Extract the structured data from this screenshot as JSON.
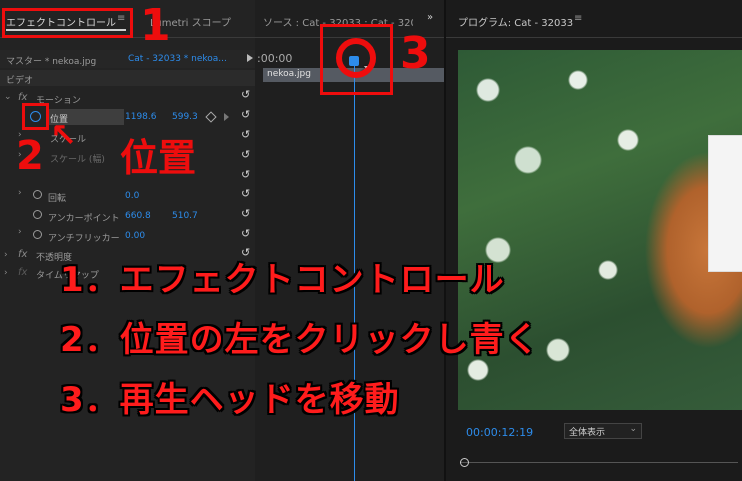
{
  "left_panel": {
    "tab_effect_controls": "エフェクトコントロール",
    "tab_menu": "≡",
    "tab_lumetri": "Lumetri スコープ",
    "master_label": "マスター * nekoa.jpg",
    "clip_label": "Cat - 32033 * nekoa...",
    "section_video": "ビデオ",
    "motion": "モーション",
    "position": "位置",
    "position_x": "1198.6",
    "position_y": "599.3",
    "scale": "スケール",
    "scale_width": "スケール (幅)",
    "rotation": "回転",
    "rotation_value": "0.0",
    "anchor": "アンカーポイント",
    "anchor_x": "660.8",
    "anchor_y": "510.7",
    "antiflicker": "アンチフリッカー",
    "antiflicker_value": "0.00",
    "opacity": "不透明度",
    "timeremap": "タイムリマップ"
  },
  "timeline": {
    "tab_source": "ソース : Cat - 32033 : Cat - 320",
    "timecode": ":00:00",
    "clip": "nekoa.jpg"
  },
  "program": {
    "title": "プログラム: Cat - 32033",
    "menu": "≡",
    "timecode": "00:00:12:19",
    "zoom": "全体表示"
  },
  "annotations": {
    "num1": "1",
    "num2": "2",
    "num3": "3",
    "position_label": "位置",
    "line1": "1．エフェクトコントロール",
    "line2": "2．位置の左をクリックし青く",
    "line3": "3．再生ヘッドを移動"
  },
  "colors": {
    "accent_red": "#ee0d0d",
    "value_blue": "#2d8ceb",
    "playhead_blue": "#2d8ceb"
  }
}
